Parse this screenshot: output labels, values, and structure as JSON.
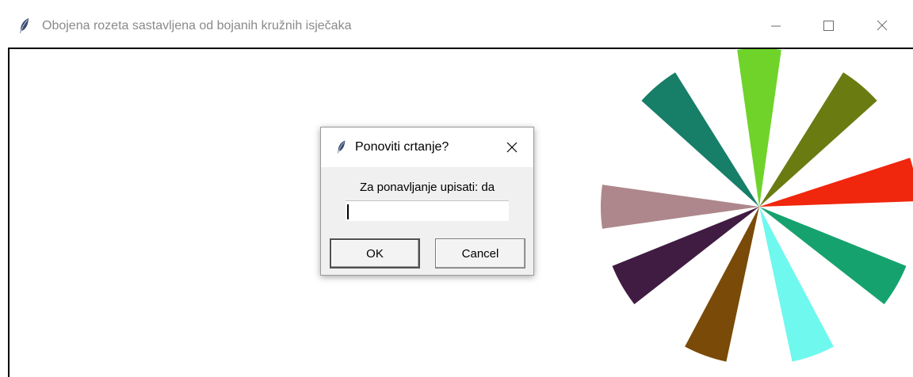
{
  "window": {
    "title": "Obojena rozeta sastavljena od bojanih kružnih isječaka",
    "icon": "feather-icon",
    "controls": [
      "minimize-icon",
      "maximize-icon",
      "close-icon"
    ]
  },
  "rosette": {
    "wedges": [
      {
        "color": "#6fd32a"
      },
      {
        "color": "#6a7b12"
      },
      {
        "color": "#f0260d"
      },
      {
        "color": "#16a26e"
      },
      {
        "color": "#6ff8ee"
      },
      {
        "color": "#7a4a08"
      },
      {
        "color": "#401b42"
      },
      {
        "color": "#ad878b"
      },
      {
        "color": "#177e68"
      }
    ]
  },
  "dialog": {
    "title": "Ponoviti crtanje?",
    "icon": "feather-icon",
    "prompt": "Za ponavljanje upisati: da",
    "input_value": "",
    "ok_label": "OK",
    "cancel_label": "Cancel"
  }
}
